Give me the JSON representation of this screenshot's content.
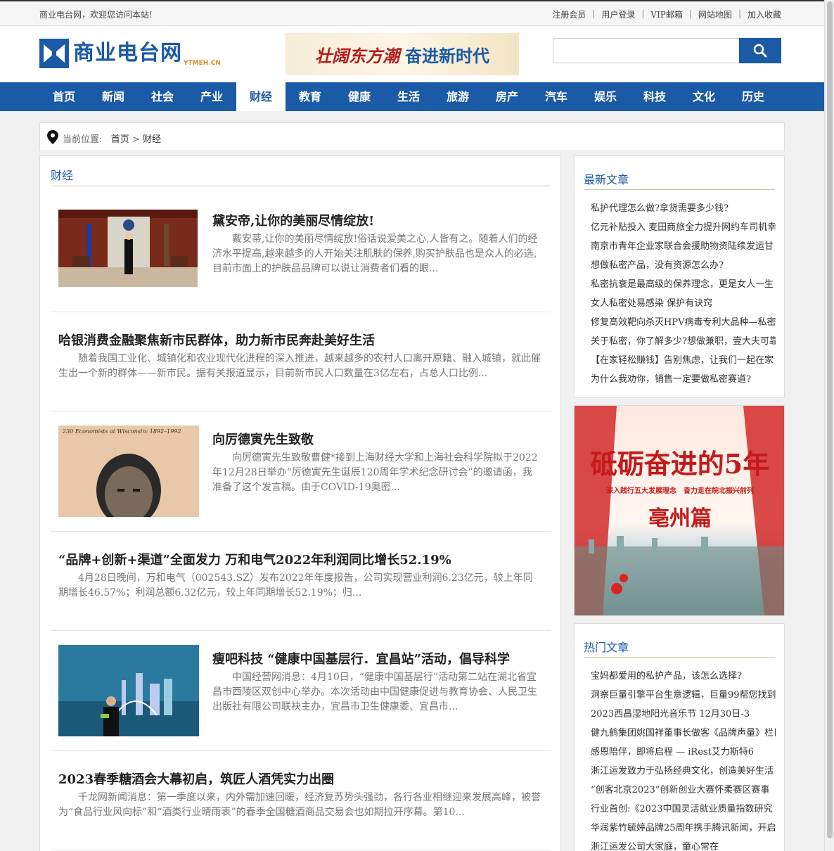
{
  "topbar": {
    "welcome": "商业电台网，欢迎您访问本站!",
    "links": [
      "注册会员",
      "用户登录",
      "VIP邮箱",
      "网站地图",
      "加入收藏"
    ]
  },
  "header": {
    "logo_text": "商业电台网",
    "logo_sub": "YTMEH.CN",
    "banner_part1": "壮阔东方潮",
    "banner_part2": "奋进新时代",
    "search_placeholder": ""
  },
  "nav": [
    "首页",
    "新闻",
    "社会",
    "产业",
    "财经",
    "教育",
    "健康",
    "生活",
    "旅游",
    "房产",
    "汽车",
    "娱乐",
    "科技",
    "文化",
    "历史"
  ],
  "nav_active": "财经",
  "breadcrumb": {
    "label": "当前位置:",
    "home": "首页",
    "separator": ">",
    "current": "财经"
  },
  "section_title": "财经",
  "articles": [
    {
      "title": "黛安帝,让你的美丽尽情绽放!",
      "summary": "戴安蒂,让你的美丽尽情绽放!俗话说爱美之心,人皆有之。随着人们的经济水平提高,越来越多的人开始关注肌肤的保养,购买护肤品也是众人的必选,目前市面上的护肤品品牌可以说让消费者们看的眼...",
      "has_image": true
    },
    {
      "title": "哈银消费金融聚焦新市民群体，助力新市民奔赴美好生活",
      "summary": "随着我国工业化、城镇化和农业现代化进程的深入推进，越来越多的农村人口离开原籍、融入城镇，就此催生出一个新的群体——新市民。据有关报道显示，目前新市民人口数量在3亿左右，占总人口比例...",
      "has_image": false
    },
    {
      "title": "向厉德寅先生致敬",
      "summary": "向厉德寅先生致敬曹健*接到上海财经大学和上海社会科学院拟于2022年12月28日举办“厉德寅先生诞辰120周年学术纪念研讨会”的邀请函，我准备了这个发言稿。由于COVID-19奥密...",
      "has_image": true,
      "image_caption": "230 Economists at Wisconsin: 1892–1992"
    },
    {
      "title": "“品牌+创新+渠道”全面发力 万和电气2022年利润同比增长52.19%",
      "summary": "4月28日晚间，万和电气（002543.SZ）发布2022年年度报告，公司实现营业利润6.23亿元，较上年同期增长46.57%；利润总额6.32亿元，较上年同期增长52.19%；归...",
      "has_image": false
    },
    {
      "title": "瘦吧科技 “健康中国基层行．宜昌站”活动，倡导科学",
      "summary": "中国经营网消息：4月10日，“健康中国基层行”活动第二站在湖北省宜昌市西陵区双创中心举办。本次活动由中国健康促进与教育协会、人民卫生出版社有限公司联袂主办，宜昌市卫生健康委、宜昌市...",
      "has_image": true
    },
    {
      "title": "2023春季糖酒会大幕初启，筑匠人酒凭实力出圈",
      "summary": "千龙网新闻消息：第一季度以来，内外需加速回暖，经济复苏势头强劲，各行各业相继迎来发展高峰，被誉为“食品行业风向标”和“酒类行业晴雨表”的春季全国糖酒商品交易会也如期拉开序幕。第10...",
      "has_image": false
    }
  ],
  "latest": {
    "title": "最新文章",
    "items": [
      "私护代理怎么做?拿货需要多少钱?",
      "亿元补贴投入 麦田商旅全力提升网约车司机幸",
      "南京市青年企业家联合会援助物资陆续发运甘",
      "想做私密产品，没有资源怎么办?",
      "私密抗衰是最高级的保养理念，更是女人一生",
      "女人私密处易感染 保护有诀窍",
      "修复高效靶向杀灭HPV病毒专利大品种—私密:",
      "关于私密，你了解多少?想做兼职，壹大夫可靠",
      "【在家轻松赚钱】告别焦虑，让我们一起在家",
      "为什么我劝你，销售一定要做私密赛道?"
    ]
  },
  "ad": {
    "headline": "砥砺奋进的5年",
    "subline": "深入践行五大发展理念　奋力走在皖北振兴前列",
    "city": "亳州篇"
  },
  "hot": {
    "title": "热门文章",
    "items": [
      "宝妈都爱用的私护产品，该怎么选择?",
      "洞察巨量引擎平台生意逻辑，巨量99帮您找到:",
      "2023西昌湿地阳光音乐节 12月30日-3",
      "健九鹤集团姚国祥董事长做客《品牌声量》栏目",
      "感恩陪伴，即将启程 — iRest艾力斯特6",
      "浙江运发致力于弘扬经典文化，创造美好生活",
      "“创客北京2023”创新创业大赛怀柔赛区赛事",
      "行业首创:《2023中国灵活就业质量指数研究",
      "华润紫竹毓婷品牌25周年携手腾讯新闻，开启",
      "浙江运发公司大家庭，童心常在"
    ]
  }
}
